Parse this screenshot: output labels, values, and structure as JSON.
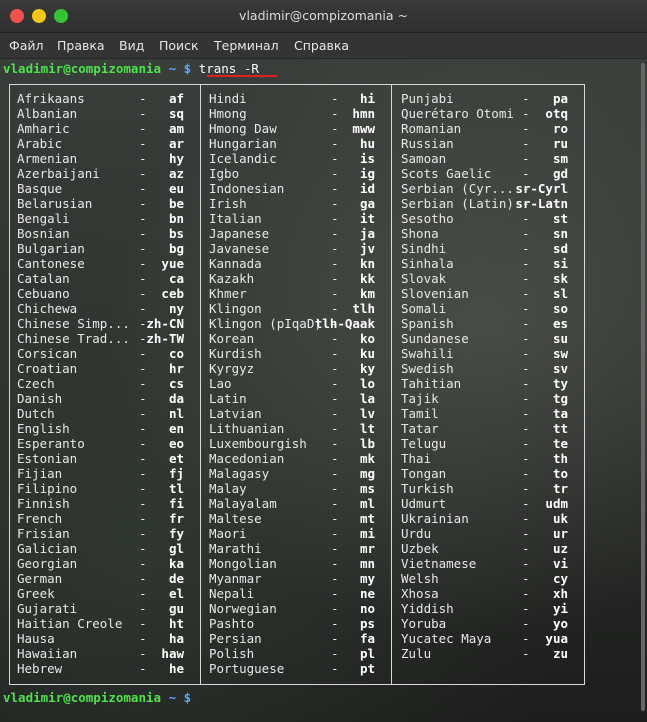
{
  "window": {
    "title": "vladimir@compizomania ~"
  },
  "menu": [
    "Файл",
    "Правка",
    "Вид",
    "Поиск",
    "Терминал",
    "Справка"
  ],
  "prompt": {
    "user_host": "vladimir@compizomania",
    "path": "~ $",
    "command": "trans -R"
  },
  "prompt_end": {
    "user_host": "vladimir@compizomania",
    "path": "~ $"
  },
  "languages": [
    [
      [
        "Afrikaans",
        "af"
      ],
      [
        "Albanian",
        "sq"
      ],
      [
        "Amharic",
        "am"
      ],
      [
        "Arabic",
        "ar"
      ],
      [
        "Armenian",
        "hy"
      ],
      [
        "Azerbaijani",
        "az"
      ],
      [
        "Basque",
        "eu"
      ],
      [
        "Belarusian",
        "be"
      ],
      [
        "Bengali",
        "bn"
      ],
      [
        "Bosnian",
        "bs"
      ],
      [
        "Bulgarian",
        "bg"
      ],
      [
        "Cantonese",
        "yue"
      ],
      [
        "Catalan",
        "ca"
      ],
      [
        "Cebuano",
        "ceb"
      ],
      [
        "Chichewa",
        "ny"
      ],
      [
        "Chinese Simp...",
        "zh-CN"
      ],
      [
        "Chinese Trad...",
        "zh-TW"
      ],
      [
        "Corsican",
        "co"
      ],
      [
        "Croatian",
        "hr"
      ],
      [
        "Czech",
        "cs"
      ],
      [
        "Danish",
        "da"
      ],
      [
        "Dutch",
        "nl"
      ],
      [
        "English",
        "en"
      ],
      [
        "Esperanto",
        "eo"
      ],
      [
        "Estonian",
        "et"
      ],
      [
        "Fijian",
        "fj"
      ],
      [
        "Filipino",
        "tl"
      ],
      [
        "Finnish",
        "fi"
      ],
      [
        "French",
        "fr"
      ],
      [
        "Frisian",
        "fy"
      ],
      [
        "Galician",
        "gl"
      ],
      [
        "Georgian",
        "ka"
      ],
      [
        "German",
        "de"
      ],
      [
        "Greek",
        "el"
      ],
      [
        "Gujarati",
        "gu"
      ],
      [
        "Haitian Creole",
        "ht"
      ],
      [
        "Hausa",
        "ha"
      ],
      [
        "Hawaiian",
        "haw"
      ],
      [
        "Hebrew",
        "he"
      ]
    ],
    [
      [
        "Hindi",
        "hi"
      ],
      [
        "Hmong",
        "hmn"
      ],
      [
        "Hmong Daw",
        "mww"
      ],
      [
        "Hungarian",
        "hu"
      ],
      [
        "Icelandic",
        "is"
      ],
      [
        "Igbo",
        "ig"
      ],
      [
        "Indonesian",
        "id"
      ],
      [
        "Irish",
        "ga"
      ],
      [
        "Italian",
        "it"
      ],
      [
        "Japanese",
        "ja"
      ],
      [
        "Javanese",
        "jv"
      ],
      [
        "Kannada",
        "kn"
      ],
      [
        "Kazakh",
        "kk"
      ],
      [
        "Khmer",
        "km"
      ],
      [
        "Klingon",
        "tlh"
      ],
      [
        "Klingon (pIqaD)",
        "tlh-Qaak"
      ],
      [
        "Korean",
        "ko"
      ],
      [
        "Kurdish",
        "ku"
      ],
      [
        "Kyrgyz",
        "ky"
      ],
      [
        "Lao",
        "lo"
      ],
      [
        "Latin",
        "la"
      ],
      [
        "Latvian",
        "lv"
      ],
      [
        "Lithuanian",
        "lt"
      ],
      [
        "Luxembourgish",
        "lb"
      ],
      [
        "Macedonian",
        "mk"
      ],
      [
        "Malagasy",
        "mg"
      ],
      [
        "Malay",
        "ms"
      ],
      [
        "Malayalam",
        "ml"
      ],
      [
        "Maltese",
        "mt"
      ],
      [
        "Maori",
        "mi"
      ],
      [
        "Marathi",
        "mr"
      ],
      [
        "Mongolian",
        "mn"
      ],
      [
        "Myanmar",
        "my"
      ],
      [
        "Nepali",
        "ne"
      ],
      [
        "Norwegian",
        "no"
      ],
      [
        "Pashto",
        "ps"
      ],
      [
        "Persian",
        "fa"
      ],
      [
        "Polish",
        "pl"
      ],
      [
        "Portuguese",
        "pt"
      ]
    ],
    [
      [
        "Punjabi",
        "pa"
      ],
      [
        "Querétaro Otomi",
        "otq"
      ],
      [
        "Romanian",
        "ro"
      ],
      [
        "Russian",
        "ru"
      ],
      [
        "Samoan",
        "sm"
      ],
      [
        "Scots Gaelic",
        "gd"
      ],
      [
        "Serbian (Cyr...",
        "sr-Cyrl"
      ],
      [
        "Serbian (Latin)",
        "sr-Latn"
      ],
      [
        "Sesotho",
        "st"
      ],
      [
        "Shona",
        "sn"
      ],
      [
        "Sindhi",
        "sd"
      ],
      [
        "Sinhala",
        "si"
      ],
      [
        "Slovak",
        "sk"
      ],
      [
        "Slovenian",
        "sl"
      ],
      [
        "Somali",
        "so"
      ],
      [
        "Spanish",
        "es"
      ],
      [
        "Sundanese",
        "su"
      ],
      [
        "Swahili",
        "sw"
      ],
      [
        "Swedish",
        "sv"
      ],
      [
        "Tahitian",
        "ty"
      ],
      [
        "Tajik",
        "tg"
      ],
      [
        "Tamil",
        "ta"
      ],
      [
        "Tatar",
        "tt"
      ],
      [
        "Telugu",
        "te"
      ],
      [
        "Thai",
        "th"
      ],
      [
        "Tongan",
        "to"
      ],
      [
        "Turkish",
        "tr"
      ],
      [
        "Udmurt",
        "udm"
      ],
      [
        "Ukrainian",
        "uk"
      ],
      [
        "Urdu",
        "ur"
      ],
      [
        "Uzbek",
        "uz"
      ],
      [
        "Vietnamese",
        "vi"
      ],
      [
        "Welsh",
        "cy"
      ],
      [
        "Xhosa",
        "xh"
      ],
      [
        "Yiddish",
        "yi"
      ],
      [
        "Yoruba",
        "yo"
      ],
      [
        "Yucatec Maya",
        "yua"
      ],
      [
        "Zulu",
        "zu"
      ]
    ]
  ],
  "separator": "-",
  "colors": {
    "user": "#4be34b",
    "path": "#5aa8ff",
    "underline": "#e02020",
    "close": "#ef5350",
    "minimize": "#f5c518",
    "maximize": "#35c236"
  }
}
